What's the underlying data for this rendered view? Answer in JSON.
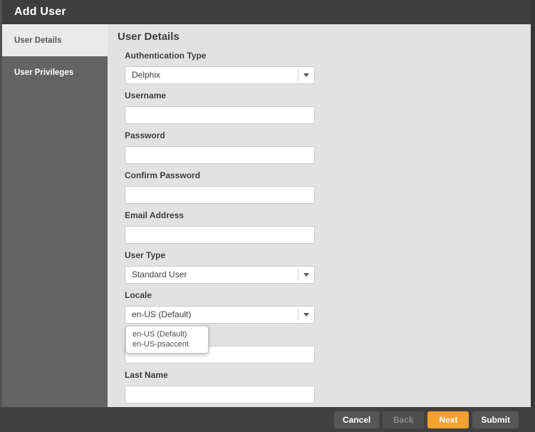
{
  "header": {
    "title": "Add User"
  },
  "sidebar": {
    "items": [
      {
        "label": "User Details",
        "active": true
      },
      {
        "label": "User Privileges",
        "active": false
      }
    ]
  },
  "content": {
    "heading": "User Details",
    "fields": [
      {
        "label": "Authentication Type",
        "type": "select",
        "value": "Delphix"
      },
      {
        "label": "Username",
        "type": "text",
        "value": ""
      },
      {
        "label": "Password",
        "type": "password",
        "value": ""
      },
      {
        "label": "Confirm Password",
        "type": "password",
        "value": ""
      },
      {
        "label": "Email Address",
        "type": "text",
        "value": ""
      },
      {
        "label": "User Type",
        "type": "select",
        "value": "Standard User"
      },
      {
        "label": "Locale",
        "type": "select",
        "value": "en-US (Default)",
        "dropdown_open": true,
        "options": [
          "en-US (Default)",
          "en-US-psaccent"
        ]
      },
      {
        "label": "",
        "type": "text",
        "value": ""
      },
      {
        "label": "Last Name",
        "type": "text",
        "value": ""
      }
    ]
  },
  "footer": {
    "buttons": [
      {
        "label": "Cancel",
        "state": "enabled"
      },
      {
        "label": "Back",
        "state": "disabled"
      },
      {
        "label": "Next",
        "state": "primary"
      },
      {
        "label": "Submit",
        "state": "enabled"
      }
    ]
  },
  "colors": {
    "accent_orange": "#F2A02E",
    "header_bg": "#3E3E3E",
    "sidebar_bg": "#646464",
    "sidebar_active_bg": "#EAEAEA",
    "content_bg": "#E2E2E2",
    "footer_bg": "#414141"
  }
}
